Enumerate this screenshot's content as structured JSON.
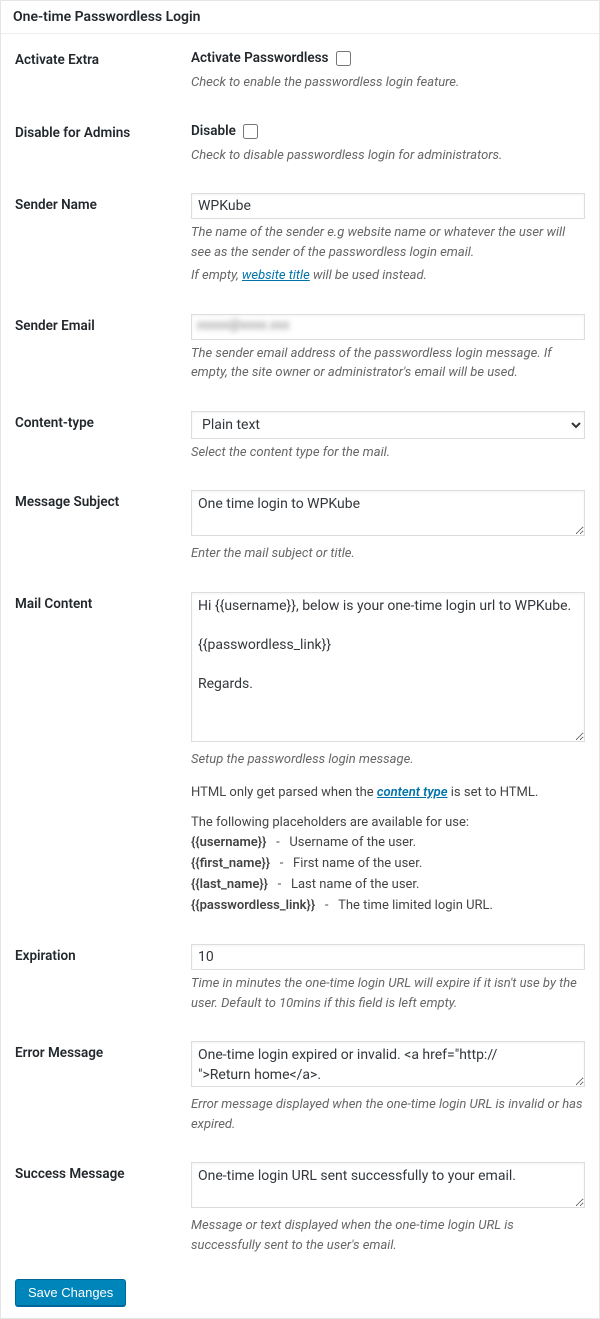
{
  "panel_title": "One-time Passwordless Login",
  "activate": {
    "label": "Activate Extra",
    "cb_label": "Activate Passwordless",
    "desc": "Check to enable the passwordless login feature."
  },
  "disable_admins": {
    "label": "Disable for Admins",
    "cb_label": "Disable",
    "desc": "Check to disable passwordless login for administrators."
  },
  "sender_name": {
    "label": "Sender Name",
    "value": "WPKube",
    "desc1": "The name of the sender e.g website name or whatever the user will see as the sender of the passwordless login email.",
    "desc2_pre": "If empty, ",
    "desc2_link": "website title",
    "desc2_post": " will be used instead."
  },
  "sender_email": {
    "label": "Sender Email",
    "value": "hidden@example.com",
    "desc": "The sender email address of the passwordless login message. If empty, the site owner or administrator's email will be used."
  },
  "content_type": {
    "label": "Content-type",
    "selected": "Plain text",
    "desc": "Select the content type for the mail."
  },
  "subject": {
    "label": "Message Subject",
    "value": "One time login to WPKube",
    "desc": "Enter the mail subject or title."
  },
  "mail_content": {
    "label": "Mail Content",
    "value": "Hi {{username}}, below is your one-time login url to WPKube.\n\n{{passwordless_link}}\n\nRegards.",
    "desc": "Setup the passwordless login message.",
    "html_note_pre": "HTML only get parsed when the ",
    "html_note_link": "content type",
    "html_note_post": " is set to HTML.",
    "ph_intro": "The following placeholders are available for use:",
    "placeholders": [
      {
        "token": "{{username}}",
        "desc": "Username of the user."
      },
      {
        "token": "{{first_name}}",
        "desc": "First name of the user."
      },
      {
        "token": "{{last_name}}",
        "desc": "Last name of the user."
      },
      {
        "token": "{{passwordless_link}}",
        "desc": "The time limited login URL."
      }
    ]
  },
  "expiration": {
    "label": "Expiration",
    "value": "10",
    "desc": "Time in minutes the one-time login URL will expire if it isn't use by the user. Default to 10mins if this field is left empty."
  },
  "error_msg": {
    "label": "Error Message",
    "value": "One-time login expired or invalid. <a href=\"http://                       \">Return home</a>.",
    "desc": "Error message displayed when the one-time login URL is invalid or has expired."
  },
  "success_msg": {
    "label": "Success Message",
    "value": "One-time login URL sent successfully to your email.",
    "desc": "Message or text displayed when the one-time login URL is successfully sent to the user's email."
  },
  "save_btn": "Save Changes"
}
